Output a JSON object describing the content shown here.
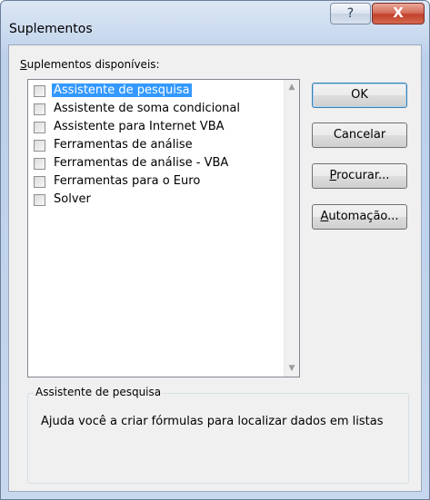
{
  "window": {
    "title": "Suplementos",
    "help_glyph": "?",
    "close_glyph": "X"
  },
  "list": {
    "label_underlined": "S",
    "label_rest": "uplementos disponíveis:",
    "items": [
      {
        "label": "Assistente de pesquisa",
        "checked": false,
        "selected": true
      },
      {
        "label": "Assistente de soma condicional",
        "checked": false,
        "selected": false
      },
      {
        "label": "Assistente para Internet VBA",
        "checked": false,
        "selected": false
      },
      {
        "label": "Ferramentas de análise",
        "checked": false,
        "selected": false
      },
      {
        "label": "Ferramentas de análise - VBA",
        "checked": false,
        "selected": false
      },
      {
        "label": "Ferramentas para o Euro",
        "checked": false,
        "selected": false
      },
      {
        "label": "Solver",
        "checked": false,
        "selected": false
      }
    ],
    "scroll_up_glyph": "▲",
    "scroll_down_glyph": "▼"
  },
  "buttons": {
    "ok": "OK",
    "cancel": "Cancelar",
    "browse_underlined": "P",
    "browse_rest": "rocurar...",
    "automation_underlined": "A",
    "automation_rest": "utomação..."
  },
  "description": {
    "title": "Assistente de pesquisa",
    "text": "Ajuda você a criar fórmulas para localizar dados em listas"
  }
}
